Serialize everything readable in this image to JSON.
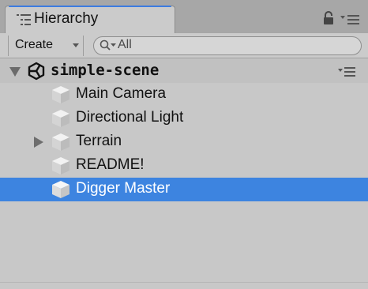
{
  "panel": {
    "tab_title": "Hierarchy",
    "tab_icon": "hierarchy-list-icon",
    "lock_icon": "lock-icon",
    "menu_icon": "panel-menu-icon"
  },
  "toolbar": {
    "create_label": "Create",
    "search_placeholder": "All"
  },
  "scene": {
    "name": "simple-scene",
    "expanded": true
  },
  "objects": [
    {
      "label": "Main Camera",
      "expandable": false,
      "selected": false
    },
    {
      "label": "Directional Light",
      "expandable": false,
      "selected": false
    },
    {
      "label": "Terrain",
      "expandable": true,
      "selected": false
    },
    {
      "label": "README!",
      "expandable": false,
      "selected": false
    },
    {
      "label": "Digger Master",
      "expandable": false,
      "selected": true
    }
  ],
  "colors": {
    "selection": "#3d84e0",
    "panel_bg": "#c8c8c8",
    "tab_accent": "#3d7ce0"
  }
}
